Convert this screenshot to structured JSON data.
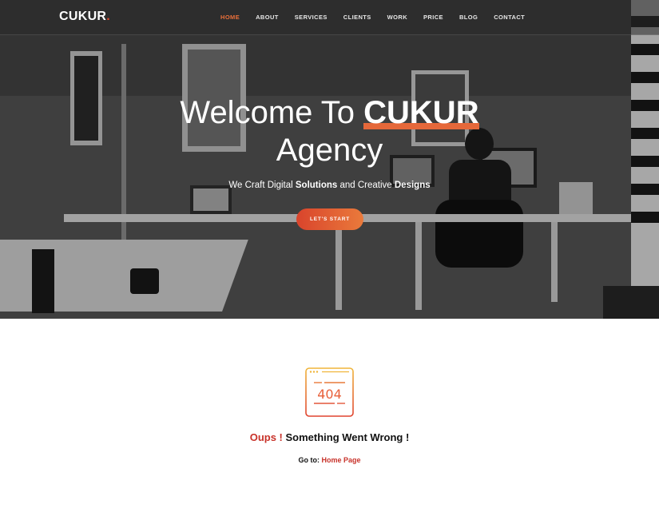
{
  "brand": {
    "name": "CUKUR",
    "dot": "."
  },
  "nav": {
    "items": [
      {
        "label": "HOME",
        "active": true
      },
      {
        "label": "ABOUT",
        "active": false
      },
      {
        "label": "SERVICES",
        "active": false
      },
      {
        "label": "CLIENTS",
        "active": false
      },
      {
        "label": "WORK",
        "active": false
      },
      {
        "label": "PRICE",
        "active": false
      },
      {
        "label": "BLOG",
        "active": false
      },
      {
        "label": "CONTACT",
        "active": false
      }
    ]
  },
  "hero": {
    "title_prefix": "Welcome To ",
    "title_brand": "CUKUR",
    "title_line2": "Agency",
    "sub_part1": "We Craft Digital ",
    "sub_bold1": "Solutions",
    "sub_part2": " and Creative ",
    "sub_bold2": "Designs",
    "cta_label": "LET'S START"
  },
  "error": {
    "icon": "404-browser-icon",
    "icon_text": "404",
    "title_accent": "Oups !",
    "title_rest": " Something Went Wrong !",
    "goto_label": "Go to: ",
    "goto_link": "Home Page"
  },
  "colors": {
    "accent": "#e5683a",
    "accent_red": "#c8322a",
    "nav_active": "#ea6f3a"
  }
}
